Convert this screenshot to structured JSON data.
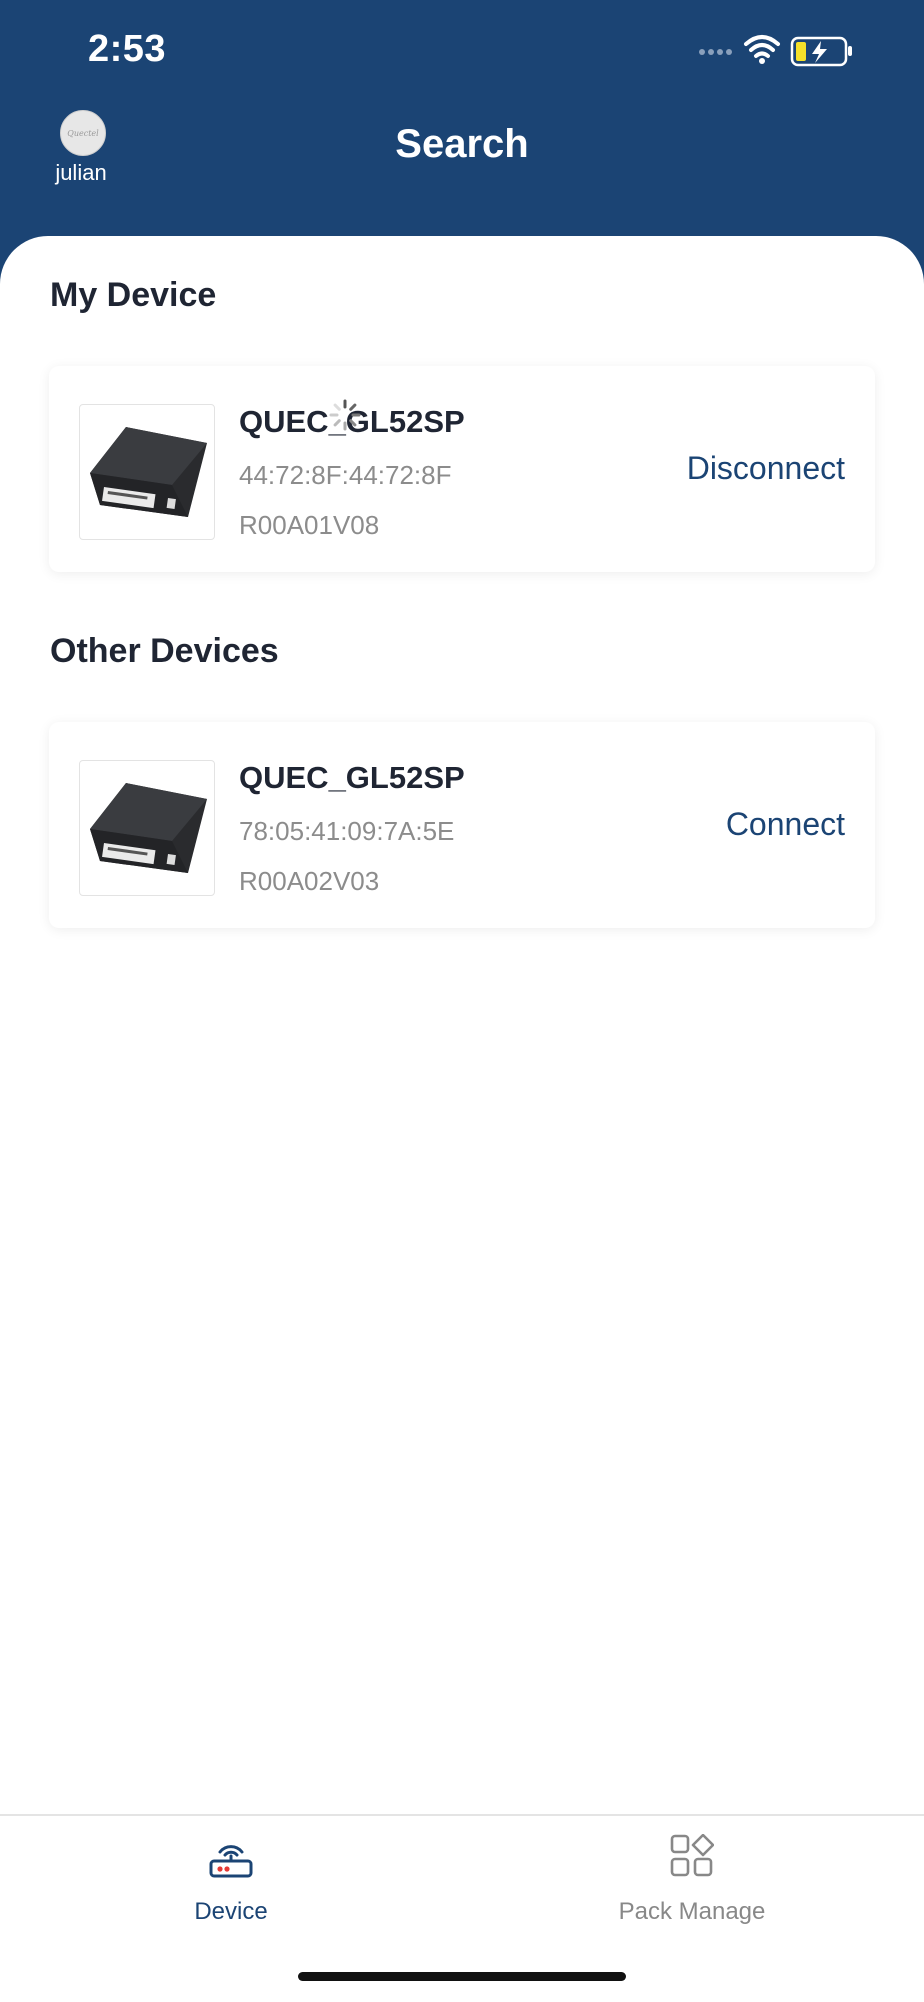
{
  "status_bar": {
    "time": "2:53",
    "icons": [
      "signal-dots-icon",
      "wifi-icon",
      "battery-charging-icon"
    ]
  },
  "header": {
    "title": "Search",
    "user": {
      "name": "julian",
      "avatar_text": "Quectel"
    }
  },
  "sections": {
    "my_device": "My Device",
    "other_devices": "Other Devices"
  },
  "my_devices": [
    {
      "name": "QUEC_GL52SP",
      "mac": "44:72:8F:44:72:8F",
      "version": "R00A01V08",
      "action": "Disconnect"
    }
  ],
  "other_devices": [
    {
      "name": "QUEC_GL52SP",
      "mac": "78:05:41:09:7A:5E",
      "version": "R00A02V03",
      "action": "Connect"
    }
  ],
  "tabs": [
    {
      "label": "Device",
      "icon": "router-icon",
      "active": true
    },
    {
      "label": "Pack Manage",
      "icon": "apps-grid-icon",
      "active": false
    }
  ],
  "colors": {
    "primary": "#1b4474",
    "text": "#1f2533",
    "muted": "#8c8c8c",
    "inactive": "#888888",
    "router_led": "#e53935"
  }
}
